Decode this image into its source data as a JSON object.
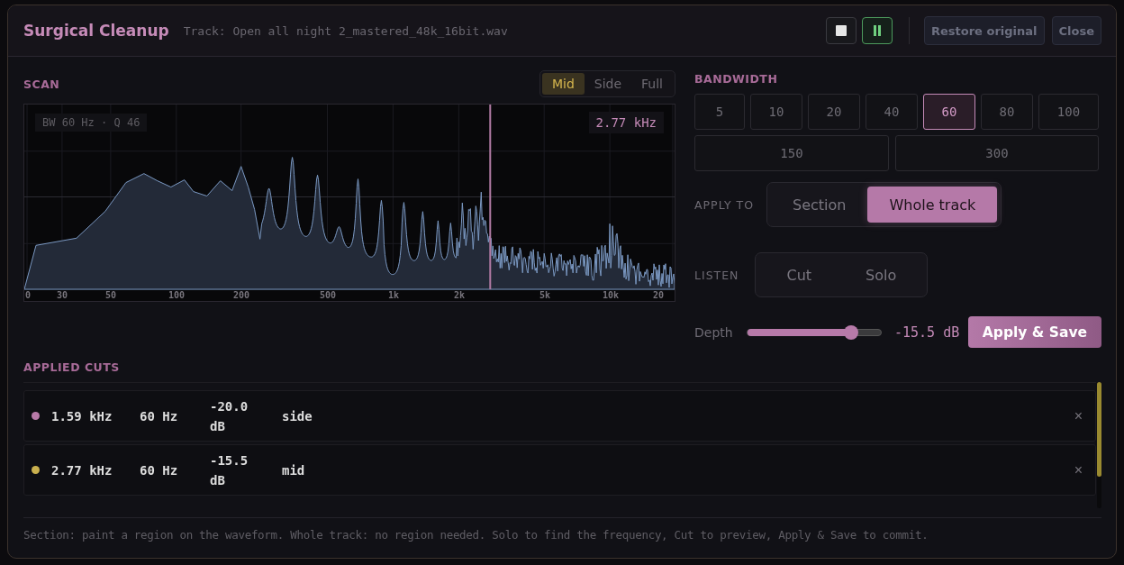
{
  "header": {
    "title": "Surgical Cleanup",
    "track": "Track: Open all night 2_mastered_48k_16bit.wav",
    "playing": true,
    "buttons": [
      "Restore original",
      "Close"
    ]
  },
  "scan": {
    "label": "SCAN",
    "modes": [
      {
        "label": "Mid",
        "selected": true
      },
      {
        "label": "Side",
        "selected": false
      },
      {
        "label": "Full",
        "selected": false
      }
    ],
    "info": "BW 60 Hz · Q 46",
    "cursor": "2.77 kHz",
    "axis_labels": [
      "0",
      "30",
      "50",
      "100",
      "200",
      "500",
      "1k",
      "2k",
      "5k",
      "10k",
      "20"
    ]
  },
  "bandwidth": {
    "label": "BANDWIDTH",
    "options": [
      {
        "label": "5",
        "selected": false
      },
      {
        "label": "10",
        "selected": false
      },
      {
        "label": "20",
        "selected": false
      },
      {
        "label": "40",
        "selected": false
      },
      {
        "label": "60",
        "selected": true
      },
      {
        "label": "80",
        "selected": false
      },
      {
        "label": "100",
        "selected": false
      },
      {
        "label": "150",
        "selected": false
      },
      {
        "label": "300",
        "selected": false
      }
    ]
  },
  "apply_to": {
    "label": "APPLY TO",
    "options": [
      {
        "label": "Section",
        "selected": false
      },
      {
        "label": "Whole track",
        "selected": true
      }
    ]
  },
  "listen": {
    "label": "LISTEN",
    "options": [
      {
        "label": "Cut",
        "selected": false
      },
      {
        "label": "Solo",
        "selected": false
      }
    ]
  },
  "depth": {
    "label": "Depth",
    "level": 0.78,
    "reading": "-15.5 dB"
  },
  "apply_button": "Apply & Save",
  "cuts": {
    "label": "APPLIED CUTS",
    "rows": [
      {
        "freq": "1.59 kHz",
        "bw": "60 Hz",
        "gain": "-20.0 dB",
        "channel": "side",
        "color": "#b87aa8",
        "remove": "×"
      },
      {
        "freq": "2.77 kHz",
        "bw": "60 Hz",
        "gain": "-15.5 dB",
        "channel": "mid",
        "color": "#c9b04e",
        "remove": "×"
      }
    ]
  },
  "hint": "Section: paint a region on the waveform. Whole track: no region needed. Solo to find the frequency, Cut to preview, Apply & Save to commit."
}
